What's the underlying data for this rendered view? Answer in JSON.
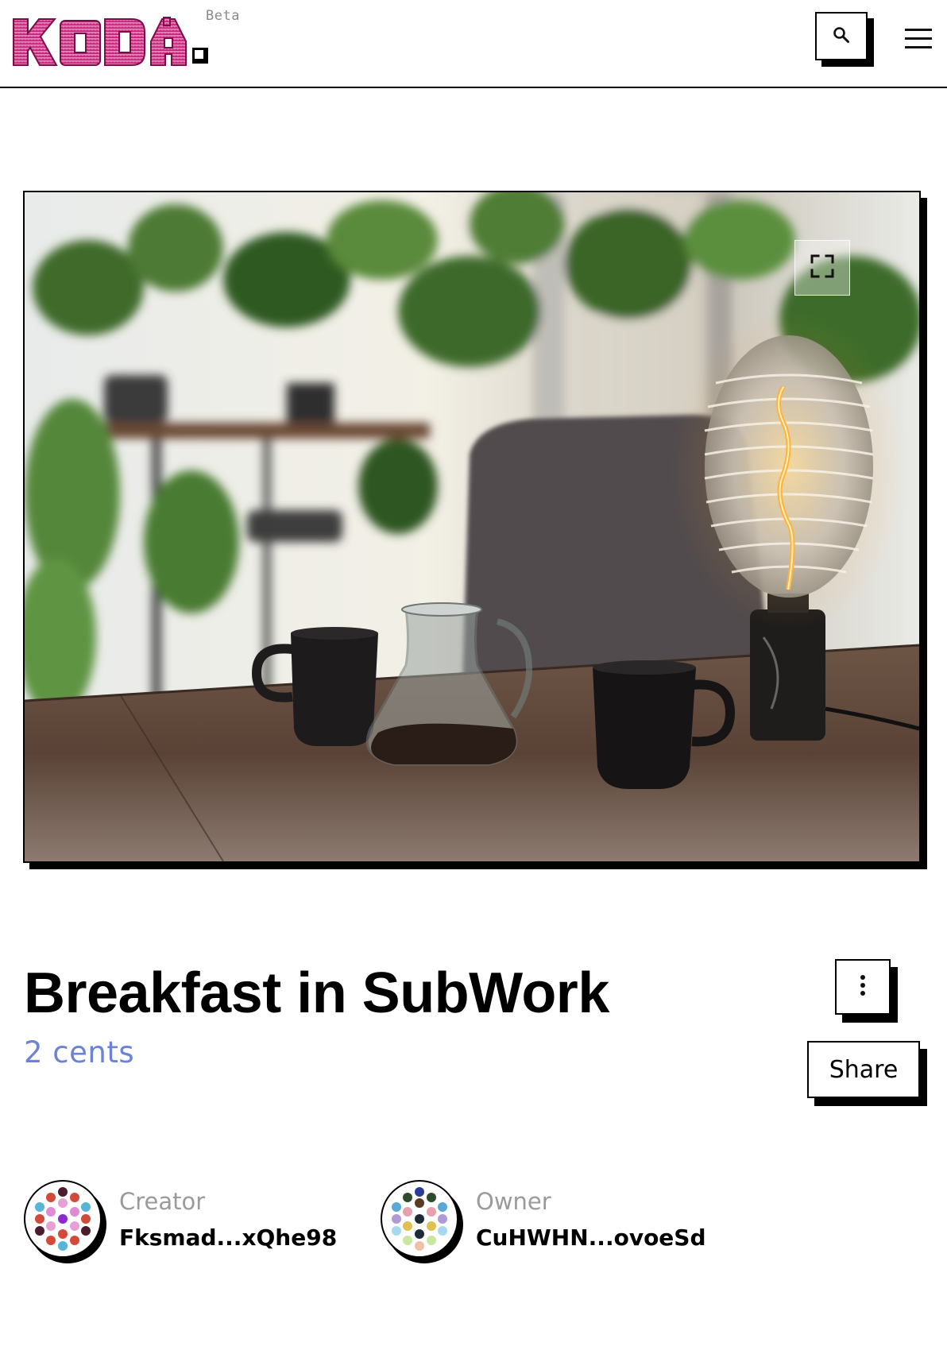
{
  "header": {
    "logo_text": "KODA",
    "beta_label": "Beta"
  },
  "icons": {
    "search": "search-icon",
    "menu": "hamburger-icon",
    "expand": "fullscreen-icon",
    "more": "vertical-dots-icon"
  },
  "nft": {
    "title": "Breakfast in SubWork",
    "price": "2 cents"
  },
  "actions": {
    "share_label": "Share"
  },
  "creator": {
    "role_label": "Creator",
    "address": "Fksmad...xQhe98"
  },
  "owner": {
    "role_label": "Owner",
    "address": "CuHWHN...ovoeSd"
  },
  "colors": {
    "accent_price": "#6b82d6",
    "logo_pink": "#e0338c",
    "border": "#000000"
  }
}
